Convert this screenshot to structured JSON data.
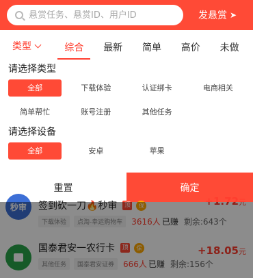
{
  "header": {
    "search_placeholder": "悬赏任务、悬赏ID、用户ID",
    "publish_label": "发悬赏",
    "accent": "#ff4a36"
  },
  "filter": {
    "type_label": "类型",
    "sort_tabs": [
      "综合",
      "最新",
      "简单",
      "高价",
      "未做"
    ],
    "active_sort": "综合"
  },
  "panel": {
    "type_title": "请选择类型",
    "type_options": [
      "全部",
      "下载体验",
      "认证绑卡",
      "电商相关",
      "简单帮忙",
      "账号注册",
      "其他任务"
    ],
    "type_selected": "全部",
    "device_title": "请选择设备",
    "device_options": [
      "全部",
      "安卓",
      "苹果"
    ],
    "device_selected": "全部",
    "reset_label": "重置",
    "confirm_label": "确定"
  },
  "list": [
    {
      "avatar_text": "秒审",
      "title": "签到砍一刀🔥秒审",
      "badge_top": "顶",
      "badge_bao": "保",
      "reward_amount": "+1.72",
      "reward_unit": "元",
      "tags": [
        "下载体验",
        "点淘-幸运购物车"
      ],
      "count": "3616人",
      "count_label": "已赚",
      "remain": "剩余:643个"
    },
    {
      "avatar_text": "",
      "title": "国泰君安一农行卡",
      "badge_top": "顶",
      "badge_bao": "保",
      "reward_amount": "+18.05",
      "reward_unit": "元",
      "tags": [
        "其他任务",
        "国泰君安证券"
      ],
      "count": "666人",
      "count_label": "已赚",
      "remain": "剩余:156个"
    }
  ]
}
